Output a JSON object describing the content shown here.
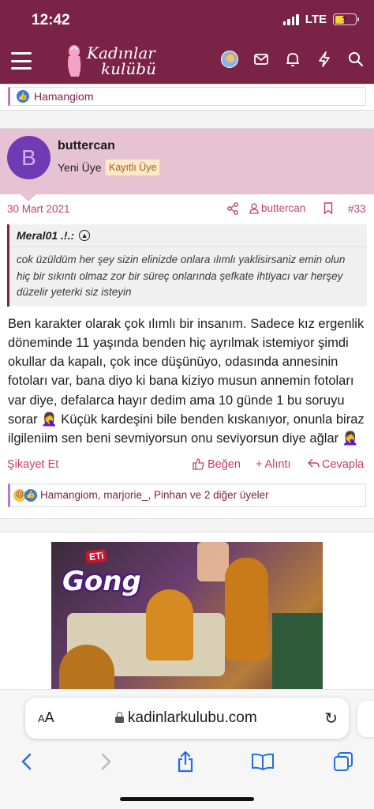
{
  "status_bar": {
    "time": "12:42",
    "network": "LTE"
  },
  "header": {
    "logo_line1": "Kadınlar",
    "logo_line2": "kulübü",
    "icons": [
      "menu-icon",
      "avatar",
      "mail-icon",
      "bell-icon",
      "bolt-icon",
      "search-icon"
    ]
  },
  "prev_reaction": {
    "text": "Hamangiom"
  },
  "post": {
    "avatar_letter": "B",
    "username": "buttercan",
    "role": "Yeni Üye",
    "badge": "Kayıtlı Üye",
    "date": "30 Mart 2021",
    "author_link": "buttercan",
    "number": "#33",
    "quote": {
      "author": "Meral01 .!.:",
      "text": "cok üzüldüm her şey sizin elinizde onlara ılımlı yaklisirsaniz emin olun hiç bir sıkıntı olmaz zor bir süreç onlarında şefkate ihtiyacı var herşey düzelir yeterki siz isteyin"
    },
    "body": "Ben karakter olarak çok ılımlı bir insanım. Sadece kız ergenlik döneminde 11 yaşında benden hiç ayrılmak istemiyor şimdi okullar da kapalı, çok ince düşünüyo, odasında annesinin fotoları var, bana diyo ki bana kiziyo musun annemin fotoları var diye, defalarca hayır dedim ama 10 günde 1 bu soruyu sorar 🤦‍♀️ Küçük kardeşini bile benden kıskanıyor, onunla biraz ilgileniim sen beni sevmiyorsun onu seviyorsun diye ağlar 🤦‍♀️",
    "actions": {
      "report": "Şikayet Et",
      "like": "Beğen",
      "quote": "Alıntı",
      "reply": "Cevapla"
    },
    "reactions": "Hamangiom, marjorie_, Pinhan ve 2 diğer üyeler"
  },
  "ad": {
    "brand": "Gong",
    "badge": "ETi"
  },
  "safari": {
    "aa_label": "AA",
    "url": "kadinlarkulubu.com"
  },
  "colors": {
    "brand": "#7a2347",
    "accent": "#c5405e",
    "head_bg": "#e6c3d2",
    "avatar_bg": "#6f3ab3"
  }
}
